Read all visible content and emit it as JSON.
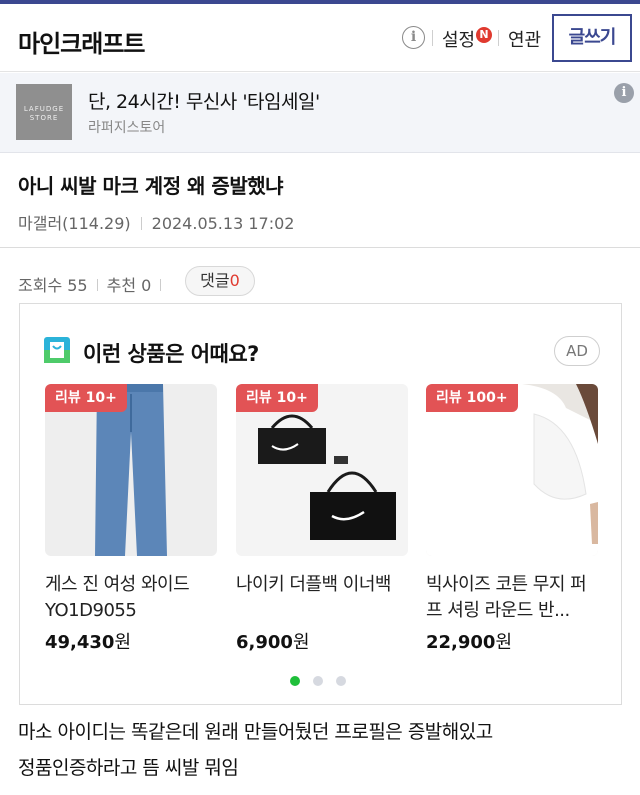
{
  "header": {
    "gallery_title": "마인크래프트",
    "settings_label": "설정",
    "new_badge": "N",
    "related_label": "연관",
    "write_button": "글쓰기",
    "info_glyph": "i"
  },
  "ad_banner": {
    "logo_text": "LAFUDGE STORE",
    "title": "단, 24시간! 무신사 '타임세일'",
    "source": "라퍼지스토어",
    "info_glyph": "i"
  },
  "post": {
    "title": "아니 씨발 마크 계정 왜 증발했냐",
    "author": "마갤러(114.29)",
    "date": "2024.05.13 17:02",
    "views_label": "조회수 55",
    "recommend_label": "추천 0",
    "comment_label": "댓글",
    "comment_count": "0",
    "body_line1": "마소 아이디는 똑같은데 원래 만들어뒀던 프로필은 증발해있고",
    "body_line2": "정품인증하라고 뜸 씨발 뭐임"
  },
  "recommendations": {
    "title": "이런 상품은 어때요?",
    "ad_label": "AD",
    "products": [
      {
        "badge": "리뷰 10+",
        "name": "게스 진 여성 와이드 YO1D9055",
        "price": "49,430",
        "unit": "원"
      },
      {
        "badge": "리뷰 10+",
        "name": "나이키 더플백 이너백",
        "price": "6,900",
        "unit": "원"
      },
      {
        "badge": "리뷰 100+",
        "name": "빅사이즈 코튼 무지 퍼프 셔링 라운드 반...",
        "price": "22,900",
        "unit": "원"
      }
    ],
    "carousel_active_index": 0,
    "carousel_count": 3
  },
  "colors": {
    "brand": "#3b4890",
    "badge_red": "#e25355",
    "active_dot": "#1fbf3a"
  }
}
